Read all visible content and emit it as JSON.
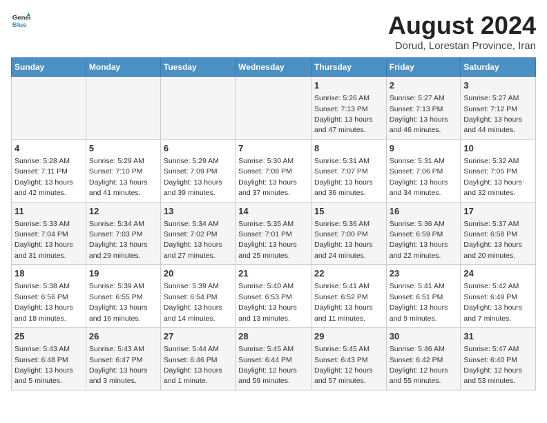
{
  "header": {
    "logo_line1": "General",
    "logo_line2": "Blue",
    "main_title": "August 2024",
    "subtitle": "Dorud, Lorestan Province, Iran"
  },
  "days_of_week": [
    "Sunday",
    "Monday",
    "Tuesday",
    "Wednesday",
    "Thursday",
    "Friday",
    "Saturday"
  ],
  "weeks": [
    [
      {
        "day": "",
        "info": ""
      },
      {
        "day": "",
        "info": ""
      },
      {
        "day": "",
        "info": ""
      },
      {
        "day": "",
        "info": ""
      },
      {
        "day": "1",
        "info": "Sunrise: 5:26 AM\nSunset: 7:13 PM\nDaylight: 13 hours\nand 47 minutes."
      },
      {
        "day": "2",
        "info": "Sunrise: 5:27 AM\nSunset: 7:13 PM\nDaylight: 13 hours\nand 46 minutes."
      },
      {
        "day": "3",
        "info": "Sunrise: 5:27 AM\nSunset: 7:12 PM\nDaylight: 13 hours\nand 44 minutes."
      }
    ],
    [
      {
        "day": "4",
        "info": "Sunrise: 5:28 AM\nSunset: 7:11 PM\nDaylight: 13 hours\nand 42 minutes."
      },
      {
        "day": "5",
        "info": "Sunrise: 5:29 AM\nSunset: 7:10 PM\nDaylight: 13 hours\nand 41 minutes."
      },
      {
        "day": "6",
        "info": "Sunrise: 5:29 AM\nSunset: 7:09 PM\nDaylight: 13 hours\nand 39 minutes."
      },
      {
        "day": "7",
        "info": "Sunrise: 5:30 AM\nSunset: 7:08 PM\nDaylight: 13 hours\nand 37 minutes."
      },
      {
        "day": "8",
        "info": "Sunrise: 5:31 AM\nSunset: 7:07 PM\nDaylight: 13 hours\nand 36 minutes."
      },
      {
        "day": "9",
        "info": "Sunrise: 5:31 AM\nSunset: 7:06 PM\nDaylight: 13 hours\nand 34 minutes."
      },
      {
        "day": "10",
        "info": "Sunrise: 5:32 AM\nSunset: 7:05 PM\nDaylight: 13 hours\nand 32 minutes."
      }
    ],
    [
      {
        "day": "11",
        "info": "Sunrise: 5:33 AM\nSunset: 7:04 PM\nDaylight: 13 hours\nand 31 minutes."
      },
      {
        "day": "12",
        "info": "Sunrise: 5:34 AM\nSunset: 7:03 PM\nDaylight: 13 hours\nand 29 minutes."
      },
      {
        "day": "13",
        "info": "Sunrise: 5:34 AM\nSunset: 7:02 PM\nDaylight: 13 hours\nand 27 minutes."
      },
      {
        "day": "14",
        "info": "Sunrise: 5:35 AM\nSunset: 7:01 PM\nDaylight: 13 hours\nand 25 minutes."
      },
      {
        "day": "15",
        "info": "Sunrise: 5:36 AM\nSunset: 7:00 PM\nDaylight: 13 hours\nand 24 minutes."
      },
      {
        "day": "16",
        "info": "Sunrise: 5:36 AM\nSunset: 6:59 PM\nDaylight: 13 hours\nand 22 minutes."
      },
      {
        "day": "17",
        "info": "Sunrise: 5:37 AM\nSunset: 6:58 PM\nDaylight: 13 hours\nand 20 minutes."
      }
    ],
    [
      {
        "day": "18",
        "info": "Sunrise: 5:38 AM\nSunset: 6:56 PM\nDaylight: 13 hours\nand 18 minutes."
      },
      {
        "day": "19",
        "info": "Sunrise: 5:39 AM\nSunset: 6:55 PM\nDaylight: 13 hours\nand 16 minutes."
      },
      {
        "day": "20",
        "info": "Sunrise: 5:39 AM\nSunset: 6:54 PM\nDaylight: 13 hours\nand 14 minutes."
      },
      {
        "day": "21",
        "info": "Sunrise: 5:40 AM\nSunset: 6:53 PM\nDaylight: 13 hours\nand 13 minutes."
      },
      {
        "day": "22",
        "info": "Sunrise: 5:41 AM\nSunset: 6:52 PM\nDaylight: 13 hours\nand 11 minutes."
      },
      {
        "day": "23",
        "info": "Sunrise: 5:41 AM\nSunset: 6:51 PM\nDaylight: 13 hours\nand 9 minutes."
      },
      {
        "day": "24",
        "info": "Sunrise: 5:42 AM\nSunset: 6:49 PM\nDaylight: 13 hours\nand 7 minutes."
      }
    ],
    [
      {
        "day": "25",
        "info": "Sunrise: 5:43 AM\nSunset: 6:48 PM\nDaylight: 13 hours\nand 5 minutes."
      },
      {
        "day": "26",
        "info": "Sunrise: 5:43 AM\nSunset: 6:47 PM\nDaylight: 13 hours\nand 3 minutes."
      },
      {
        "day": "27",
        "info": "Sunrise: 5:44 AM\nSunset: 6:46 PM\nDaylight: 13 hours\nand 1 minute."
      },
      {
        "day": "28",
        "info": "Sunrise: 5:45 AM\nSunset: 6:44 PM\nDaylight: 12 hours\nand 59 minutes."
      },
      {
        "day": "29",
        "info": "Sunrise: 5:45 AM\nSunset: 6:43 PM\nDaylight: 12 hours\nand 57 minutes."
      },
      {
        "day": "30",
        "info": "Sunrise: 5:46 AM\nSunset: 6:42 PM\nDaylight: 12 hours\nand 55 minutes."
      },
      {
        "day": "31",
        "info": "Sunrise: 5:47 AM\nSunset: 6:40 PM\nDaylight: 12 hours\nand 53 minutes."
      }
    ]
  ]
}
